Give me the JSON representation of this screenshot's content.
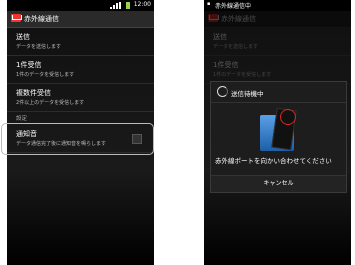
{
  "left": {
    "status": {
      "time": "12:00"
    },
    "appbar": {
      "title": "赤外線通信",
      "icon": "mail-icon"
    },
    "items": [
      {
        "title": "送信",
        "sub": "データを送信します"
      },
      {
        "title": "1件受信",
        "sub": "1件のデータを受信します"
      },
      {
        "title": "複数件受信",
        "sub": "2件以上のデータを受信します"
      }
    ],
    "section": "設定",
    "setting": {
      "title": "通知音",
      "sub": "データ通信完了後に通知音を鳴らします",
      "checked": false
    }
  },
  "right": {
    "status": {
      "text": "赤外線通信中"
    },
    "appbar": {
      "title": "赤外線通信"
    },
    "items": [
      {
        "title": "送信",
        "sub": "データを送信します"
      },
      {
        "title": "1件受信",
        "sub": "1件のデータを受信します"
      }
    ],
    "dialog": {
      "title": "送信待機中",
      "message": "赤外線ポートを向かい合わせてください",
      "cancel": "キャンセル"
    }
  }
}
